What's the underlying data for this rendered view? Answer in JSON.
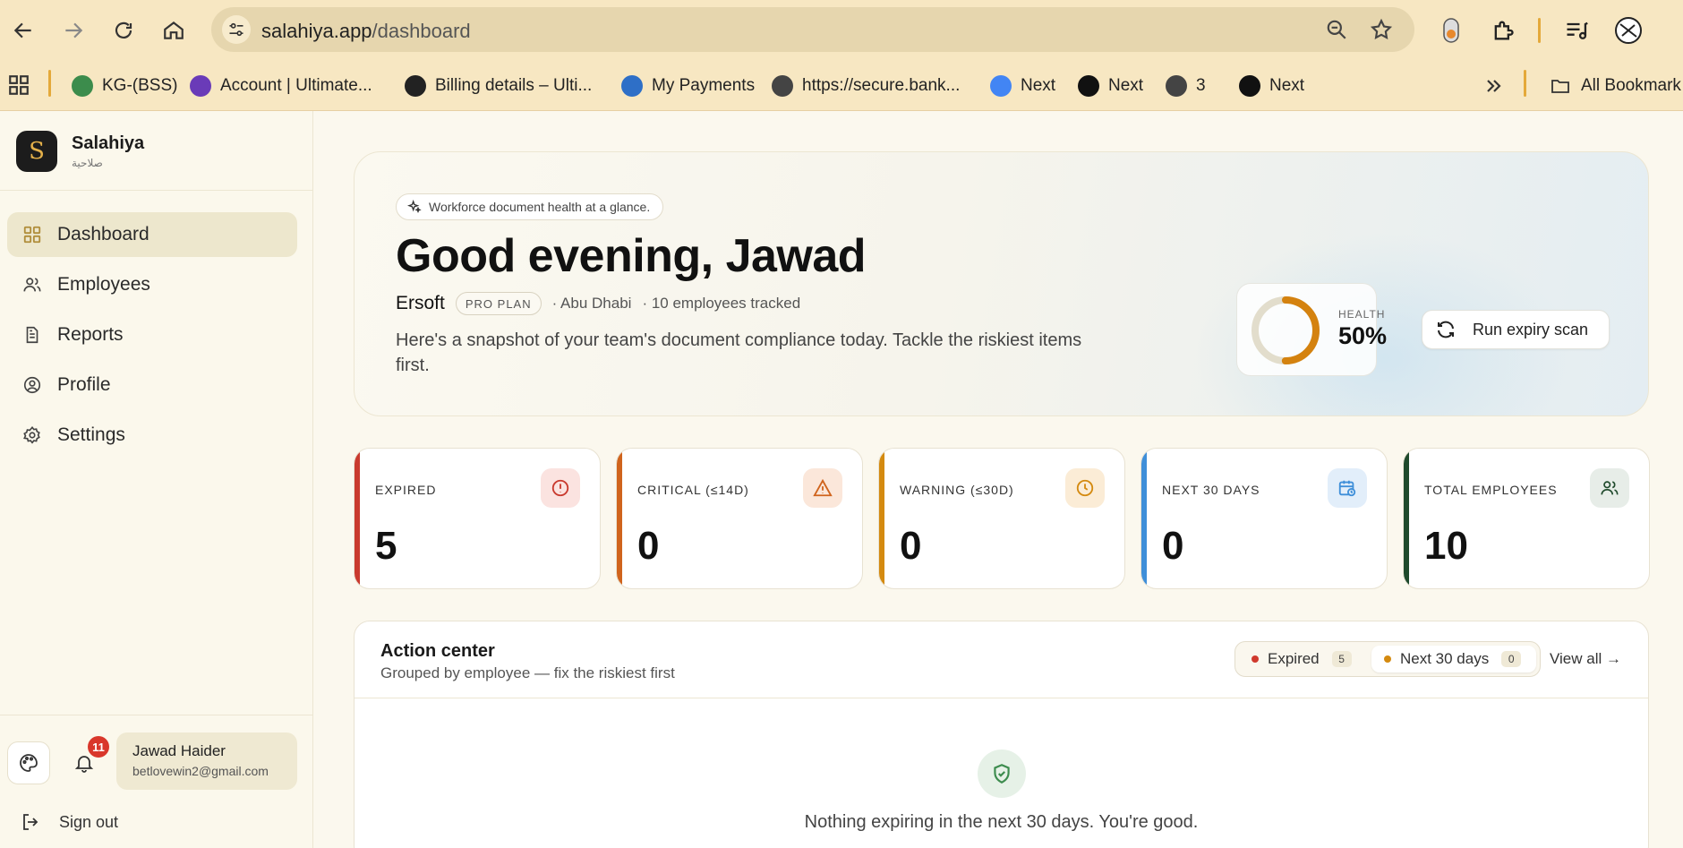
{
  "browser": {
    "url_host": "salahiya.app",
    "url_path": "/dashboard",
    "bookmarks": [
      {
        "label": "KG-(BSS)",
        "icon": "sheet-icon",
        "color": "#3c8c4c"
      },
      {
        "label": "Account | Ultimate...",
        "icon": "hippo-icon",
        "color": "#6a3bb8"
      },
      {
        "label": "Billing details – Ulti...",
        "icon": "q-icon",
        "color": "#222222"
      },
      {
        "label": "My Payments",
        "icon": "card-icon",
        "color": "#2e6fc7"
      },
      {
        "label": "https://secure.bank...",
        "icon": "globe-icon",
        "color": "#444444"
      },
      {
        "label": "Next",
        "icon": "google-icon",
        "color": "#4285f4"
      },
      {
        "label": "Next",
        "icon": "upwork-icon",
        "color": "#111111"
      },
      {
        "label": "3",
        "icon": "globe-icon",
        "color": "#444444"
      },
      {
        "label": "Next",
        "icon": "upwork-icon",
        "color": "#111111"
      }
    ],
    "all_bookmarks": "All Bookmark"
  },
  "sidebar": {
    "brand_name": "Salahiya",
    "brand_sub": "صلاحية",
    "brand_letter": "S",
    "items": [
      {
        "label": "Dashboard",
        "icon": "grid-icon",
        "active": true
      },
      {
        "label": "Employees",
        "icon": "users-icon",
        "active": false
      },
      {
        "label": "Reports",
        "icon": "document-icon",
        "active": false
      },
      {
        "label": "Profile",
        "icon": "user-circle-icon",
        "active": false
      },
      {
        "label": "Settings",
        "icon": "gear-icon",
        "active": false
      }
    ],
    "notifications": "11",
    "user_name": "Jawad Haider",
    "user_email": "betlovewin2@gmail.com",
    "sign_out": "Sign out"
  },
  "hero": {
    "pill": "Workforce document health at a glance.",
    "greeting": "Good evening, Jawad",
    "org": "Ersoft",
    "plan": "PRO PLAN",
    "location": "· Abu Dhabi",
    "tracked": "· 10 employees tracked",
    "description": "Here's a snapshot of your team's document compliance today. Tackle the riskiest items first.",
    "health_label": "HEALTH",
    "health_value": "50%",
    "health_fraction": 0.5,
    "scan_label": "Run expiry scan"
  },
  "stats": [
    {
      "label": "EXPIRED",
      "value": "5",
      "color": "#c93a2e",
      "bg": "#fbe3e0",
      "icon": "alert-circle-icon"
    },
    {
      "label": "CRITICAL (≤14D)",
      "value": "0",
      "color": "#d0641d",
      "bg": "#fbe7da",
      "icon": "warning-triangle-icon"
    },
    {
      "label": "WARNING (≤30D)",
      "value": "0",
      "color": "#d48a10",
      "bg": "#fbecd6",
      "icon": "clock-icon"
    },
    {
      "label": "NEXT 30 DAYS",
      "value": "0",
      "color": "#3f8fd9",
      "bg": "#e2eefa",
      "icon": "calendar-clock-icon"
    },
    {
      "label": "TOTAL EMPLOYEES",
      "value": "10",
      "color": "#1f4a2c",
      "bg": "#e7ede8",
      "icon": "users-icon"
    }
  ],
  "action_center": {
    "title": "Action center",
    "subtitle": "Grouped by employee — fix the riskiest first",
    "filters": [
      {
        "label": "Expired",
        "count": "5",
        "color": "#d0392d",
        "selected": false
      },
      {
        "label": "Next 30 days",
        "count": "0",
        "color": "#d48a10",
        "selected": true
      }
    ],
    "view_all": "View all →",
    "empty_text": "Nothing expiring in the next 30 days. You're good."
  }
}
